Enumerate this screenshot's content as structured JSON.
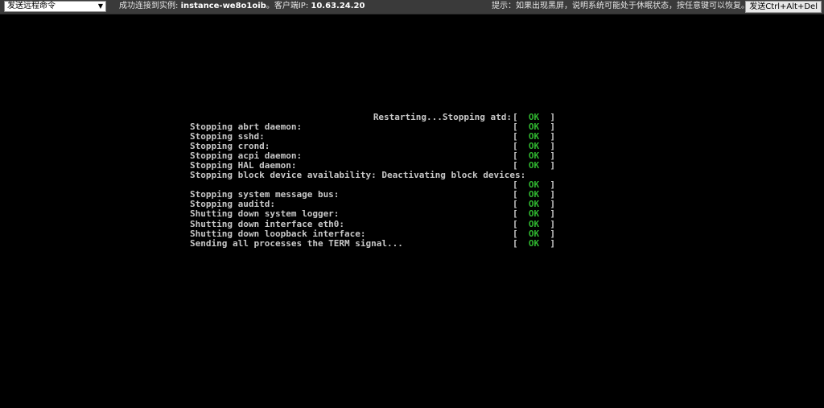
{
  "toolbar": {
    "command_select": "发送远程命令",
    "connection_prefix": "成功连接到实例:",
    "instance_id": "instance-we8o1oib",
    "client_ip_label": "。客户端IP:",
    "client_ip": "10.63.24.20",
    "hint": "提示：如果出现黑屏，说明系统可能处于休眠状态，按任意键可以恢复。",
    "send_cad_button": "发送Ctrl+Alt+Del"
  },
  "status_open": "[",
  "status_close": "]",
  "ok_label": "OK",
  "ok_color": "#2fb52f",
  "terminal_lines": [
    {
      "msg": "Restarting...Stopping atd:",
      "status": true
    },
    {
      "msg": "Stopping abrt daemon:",
      "status": true
    },
    {
      "msg": "Stopping sshd:",
      "status": true
    },
    {
      "msg": "Stopping crond:",
      "status": true
    },
    {
      "msg": "Stopping acpi daemon:",
      "status": true
    },
    {
      "msg": "Stopping HAL daemon:",
      "status": true
    },
    {
      "msg": "Stopping block device availability: Deactivating block devices:",
      "status": false
    },
    {
      "msg": "",
      "status": true
    },
    {
      "msg": "Stopping system message bus:",
      "status": true
    },
    {
      "msg": "Stopping auditd:",
      "status": true
    },
    {
      "msg": "Shutting down system logger:",
      "status": true
    },
    {
      "msg": "Shutting down interface eth0:",
      "status": true
    },
    {
      "msg": "Shutting down loopback interface:",
      "status": true
    },
    {
      "msg": "Sending all processes the TERM signal...",
      "status": true
    }
  ]
}
